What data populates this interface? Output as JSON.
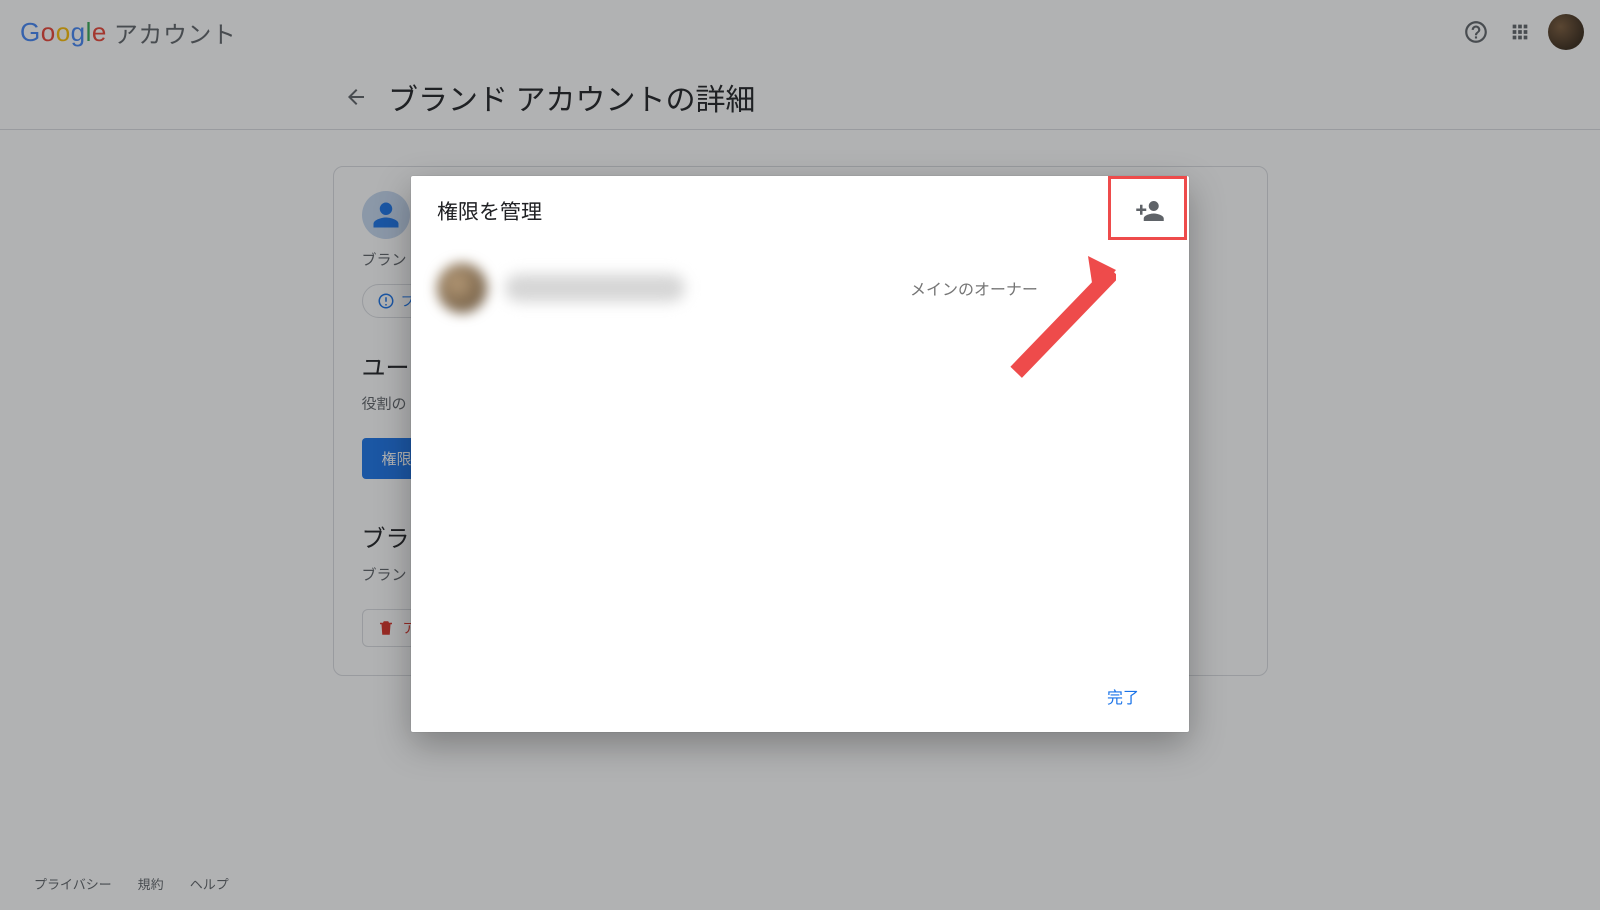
{
  "header": {
    "app_name": "アカウント",
    "page_title": "ブランド アカウントの詳細"
  },
  "card": {
    "brand_label_prefix": "ブラン",
    "chip_prefix": "フ",
    "section_users": "ユー",
    "section_users_desc": "役割の",
    "manage_button": "権限",
    "section_brand": "ブラ",
    "section_brand_desc": "ブラン",
    "danger_prefix": "ア"
  },
  "dialog": {
    "title": "権限を管理",
    "member_role": "メインのオーナー",
    "done": "完了"
  },
  "footer": {
    "privacy": "プライバシー",
    "terms": "規約",
    "help": "ヘルプ"
  }
}
